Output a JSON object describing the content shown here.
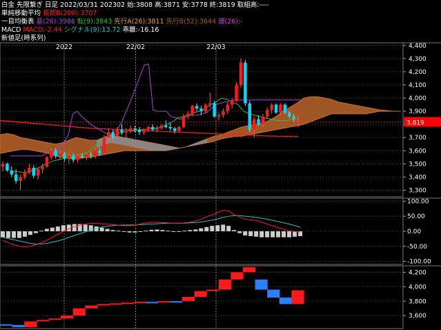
{
  "header": {
    "line1": "白金 先限繋ぎ 日足 2022/03/31 202302 始:3808 高:3871 安:3778 終:3819 取組高:----",
    "ma_label": "単純移動平均",
    "ma_long": "長期B(200):3707",
    "ichimoku_label": "一目均衡表",
    "ichimoku_base": "基(26):3986",
    "ichimoku_conv": "転(9):3843",
    "ichimoku_spanA": "先行A(26):3811",
    "ichimoku_spanB": "先行B(52):3644",
    "ichimoku_lag": "遅(26):-",
    "macd_label": "MACD",
    "macd_value": "MACD:-2.44",
    "macd_signal": "シグナル(9):13.72",
    "macd_hist": "乖離:-16.16",
    "newprice_label": "新値足(時系列)"
  },
  "colors": {
    "up": "#ff1a1a",
    "down": "#00d8ff",
    "cloud": "#b8652a",
    "cloud_neg": "#8a8a8a",
    "kijun": "#b040e0",
    "tenkan": "#30c030",
    "ma200": "#ff2020",
    "macd": "#ff2020",
    "signal": "#30c0c0",
    "hist": "#cccccc",
    "current_price_bg": "#ff0000",
    "grid": "#555555"
  },
  "chart_data": [
    {
      "type": "candlestick",
      "title": "",
      "x_labels": [
        "2022",
        "22/02",
        "22/03"
      ],
      "y_ticks": [
        "4,400",
        "4,300",
        "4,200",
        "4,100",
        "4,000",
        "3,900",
        "3,800",
        "3,700",
        "3,600",
        "3,500",
        "3,400",
        "3,300"
      ],
      "ylim": [
        3250,
        4420
      ],
      "current_price": "3,819",
      "x_range_end": 110,
      "candles": [
        {
          "o": 3480,
          "h": 3520,
          "l": 3440,
          "c": 3500
        },
        {
          "o": 3500,
          "h": 3510,
          "l": 3440,
          "c": 3450
        },
        {
          "o": 3450,
          "h": 3480,
          "l": 3400,
          "c": 3420
        },
        {
          "o": 3420,
          "h": 3460,
          "l": 3350,
          "c": 3370
        },
        {
          "o": 3370,
          "h": 3420,
          "l": 3300,
          "c": 3400
        },
        {
          "o": 3400,
          "h": 3460,
          "l": 3380,
          "c": 3440
        },
        {
          "o": 3440,
          "h": 3500,
          "l": 3420,
          "c": 3470
        },
        {
          "o": 3470,
          "h": 3490,
          "l": 3390,
          "c": 3410
        },
        {
          "o": 3410,
          "h": 3470,
          "l": 3380,
          "c": 3460
        },
        {
          "o": 3460,
          "h": 3500,
          "l": 3430,
          "c": 3480
        },
        {
          "o": 3480,
          "h": 3560,
          "l": 3470,
          "c": 3550
        },
        {
          "o": 3550,
          "h": 3620,
          "l": 3530,
          "c": 3600
        },
        {
          "o": 3600,
          "h": 3620,
          "l": 3540,
          "c": 3560
        },
        {
          "o": 3560,
          "h": 3600,
          "l": 3530,
          "c": 3580
        },
        {
          "o": 3580,
          "h": 3590,
          "l": 3520,
          "c": 3540
        },
        {
          "o": 3540,
          "h": 3580,
          "l": 3500,
          "c": 3560
        },
        {
          "o": 3560,
          "h": 3580,
          "l": 3510,
          "c": 3530
        },
        {
          "o": 3530,
          "h": 3570,
          "l": 3510,
          "c": 3560
        },
        {
          "o": 3560,
          "h": 3580,
          "l": 3540,
          "c": 3550
        },
        {
          "o": 3550,
          "h": 3580,
          "l": 3530,
          "c": 3570
        },
        {
          "o": 3570,
          "h": 3590,
          "l": 3540,
          "c": 3560
        },
        {
          "o": 3560,
          "h": 3620,
          "l": 3540,
          "c": 3600
        },
        {
          "o": 3600,
          "h": 3620,
          "l": 3560,
          "c": 3580
        },
        {
          "o": 3580,
          "h": 3720,
          "l": 3570,
          "c": 3700
        },
        {
          "o": 3700,
          "h": 3770,
          "l": 3680,
          "c": 3740
        },
        {
          "o": 3740,
          "h": 3760,
          "l": 3690,
          "c": 3710
        },
        {
          "o": 3710,
          "h": 3780,
          "l": 3700,
          "c": 3760
        },
        {
          "o": 3760,
          "h": 3800,
          "l": 3720,
          "c": 3740
        },
        {
          "o": 3740,
          "h": 3770,
          "l": 3700,
          "c": 3750
        },
        {
          "o": 3750,
          "h": 3790,
          "l": 3730,
          "c": 3770
        },
        {
          "o": 3770,
          "h": 3790,
          "l": 3740,
          "c": 3760
        },
        {
          "o": 3760,
          "h": 3780,
          "l": 3720,
          "c": 3740
        },
        {
          "o": 3740,
          "h": 3770,
          "l": 3720,
          "c": 3760
        },
        {
          "o": 3760,
          "h": 3790,
          "l": 3740,
          "c": 3780
        },
        {
          "o": 3780,
          "h": 3800,
          "l": 3750,
          "c": 3760
        },
        {
          "o": 3760,
          "h": 3790,
          "l": 3740,
          "c": 3770
        },
        {
          "o": 3770,
          "h": 3800,
          "l": 3760,
          "c": 3790
        },
        {
          "o": 3790,
          "h": 3830,
          "l": 3770,
          "c": 3780
        },
        {
          "o": 3780,
          "h": 3810,
          "l": 3750,
          "c": 3770
        },
        {
          "o": 3770,
          "h": 3780,
          "l": 3730,
          "c": 3750
        },
        {
          "o": 3750,
          "h": 3790,
          "l": 3740,
          "c": 3780
        },
        {
          "o": 3780,
          "h": 3880,
          "l": 3770,
          "c": 3860
        },
        {
          "o": 3860,
          "h": 3900,
          "l": 3840,
          "c": 3880
        },
        {
          "o": 3880,
          "h": 3950,
          "l": 3860,
          "c": 3940
        },
        {
          "o": 3940,
          "h": 3960,
          "l": 3900,
          "c": 3920
        },
        {
          "o": 3920,
          "h": 3940,
          "l": 3870,
          "c": 3900
        },
        {
          "o": 3900,
          "h": 3960,
          "l": 3890,
          "c": 3950
        },
        {
          "o": 3950,
          "h": 4040,
          "l": 3930,
          "c": 3960
        },
        {
          "o": 3960,
          "h": 3980,
          "l": 3850,
          "c": 3860
        },
        {
          "o": 3860,
          "h": 3890,
          "l": 3830,
          "c": 3870
        },
        {
          "o": 3870,
          "h": 3920,
          "l": 3850,
          "c": 3900
        },
        {
          "o": 3900,
          "h": 3970,
          "l": 3880,
          "c": 3950
        },
        {
          "o": 3950,
          "h": 4000,
          "l": 3920,
          "c": 3980
        },
        {
          "o": 3980,
          "h": 4120,
          "l": 3970,
          "c": 4100
        },
        {
          "o": 4100,
          "h": 4300,
          "l": 4080,
          "c": 4270
        },
        {
          "o": 4270,
          "h": 4290,
          "l": 3940,
          "c": 3960
        },
        {
          "o": 3960,
          "h": 3980,
          "l": 3740,
          "c": 3760
        },
        {
          "o": 3760,
          "h": 3860,
          "l": 3700,
          "c": 3840
        },
        {
          "o": 3840,
          "h": 3870,
          "l": 3790,
          "c": 3800
        },
        {
          "o": 3800,
          "h": 3880,
          "l": 3780,
          "c": 3860
        },
        {
          "o": 3860,
          "h": 3930,
          "l": 3840,
          "c": 3910
        },
        {
          "o": 3910,
          "h": 3960,
          "l": 3880,
          "c": 3950
        },
        {
          "o": 3950,
          "h": 3960,
          "l": 3880,
          "c": 3890
        },
        {
          "o": 3890,
          "h": 3960,
          "l": 3870,
          "c": 3950
        },
        {
          "o": 3950,
          "h": 3960,
          "l": 3880,
          "c": 3890
        },
        {
          "o": 3890,
          "h": 3900,
          "l": 3850,
          "c": 3860
        },
        {
          "o": 3860,
          "h": 3880,
          "l": 3820,
          "c": 3840
        },
        {
          "o": 3808,
          "h": 3871,
          "l": 3778,
          "c": 3819
        }
      ],
      "ma200": [
        3830,
        3826,
        3822,
        3818,
        3814,
        3810,
        3806,
        3802,
        3798,
        3794,
        3790,
        3786,
        3782,
        3778,
        3774,
        3770,
        3768,
        3766,
        3764,
        3762,
        3760,
        3758,
        3756,
        3754,
        3752,
        3750,
        3748,
        3746,
        3744,
        3742,
        3740,
        3738,
        3736,
        3734,
        3732,
        3730,
        3728,
        3726,
        3724,
        3722,
        3720,
        3718,
        3716,
        3714,
        3712,
        3711,
        3710,
        3709,
        3708,
        3707
      ],
      "kijun": [
        3560,
        3560,
        3560,
        3560,
        3560,
        3560,
        3560,
        3560,
        3580,
        3580,
        3580,
        3620,
        3660,
        3720,
        3880,
        3900,
        3860,
        3830,
        3800,
        3780,
        3760,
        3740,
        3720,
        3740,
        3760,
        3820,
        3900,
        3980,
        4070,
        4160,
        4250,
        4260,
        3910,
        3900,
        3900,
        3900,
        3860,
        3850,
        3840,
        3850,
        3870,
        3870,
        3870,
        3880,
        3890,
        3920,
        3950,
        3960,
        3970,
        3975,
        3985,
        3985,
        3985,
        3985,
        3985,
        3986,
        3986,
        3986,
        3986,
        3986,
        3986,
        3986,
        3986,
        3986,
        3986,
        3986
      ],
      "tenkan": [
        3440,
        3440,
        3430,
        3440,
        3460,
        3480,
        3500,
        3520,
        3530,
        3540,
        3550,
        3560,
        3570,
        3580,
        3600,
        3640,
        3680,
        3700,
        3720,
        3730,
        3740,
        3750,
        3750,
        3760,
        3760,
        3770,
        3770,
        3780,
        3800,
        3820,
        3850,
        3860,
        3870,
        3890,
        3900,
        3920,
        3950,
        3970,
        4000,
        3990,
        3970,
        3950,
        3900,
        3880,
        3870,
        3860,
        3850,
        3840,
        3830,
        3830,
        3830,
        3840,
        3843
      ],
      "cloud_top": [
        3720,
        3730,
        3720,
        3700,
        3690,
        3680,
        3670,
        3660,
        3650,
        3660,
        3680,
        3700,
        3690,
        3680,
        3680,
        3700,
        3720,
        3710,
        3700,
        3690,
        3680,
        3670,
        3660,
        3650,
        3640,
        3630,
        3620,
        3630,
        3650,
        3670,
        3690,
        3710,
        3720,
        3740,
        3760,
        3780,
        3790,
        3800,
        3810,
        3830,
        3860,
        3900,
        3930,
        3960,
        4000,
        4010,
        4010,
        4000,
        3990,
        3970,
        3960,
        3950,
        3940,
        3930,
        3920,
        3910,
        3905,
        3900,
        3900
      ],
      "cloud_bot": [
        3580,
        3590,
        3600,
        3610,
        3610,
        3600,
        3590,
        3580,
        3560,
        3550,
        3540,
        3540,
        3545,
        3550,
        3560,
        3570,
        3580,
        3590,
        3600,
        3600,
        3600,
        3600,
        3600,
        3600,
        3600,
        3610,
        3620,
        3630,
        3640,
        3650,
        3660,
        3670,
        3690,
        3700,
        3710,
        3710,
        3720,
        3730,
        3740,
        3750,
        3760,
        3770,
        3780,
        3790,
        3800,
        3820,
        3840,
        3860,
        3880,
        3880,
        3880,
        3880,
        3880,
        3880,
        3890,
        3900,
        3900,
        3900,
        3900
      ]
    },
    {
      "type": "macd",
      "title": "",
      "y_ticks": [
        "100.00",
        "50.00",
        "0.00",
        "-50.00",
        "-100.00"
      ],
      "ylim": [
        -110,
        110
      ],
      "macd": [
        -30,
        -38,
        -45,
        -50,
        -52,
        -50,
        -45,
        -38,
        -30,
        -20,
        -10,
        0,
        8,
        15,
        20,
        24,
        26,
        26,
        25,
        24,
        22,
        20,
        18,
        18,
        20,
        24,
        28,
        30,
        30,
        29,
        28,
        27,
        27,
        28,
        30,
        34,
        40,
        48,
        55,
        62,
        70,
        68,
        55,
        48,
        40,
        38,
        36,
        30,
        24,
        18,
        12,
        6,
        2,
        -1,
        -2.44
      ],
      "signal": [
        -20,
        -24,
        -28,
        -32,
        -36,
        -40,
        -42,
        -42,
        -40,
        -36,
        -32,
        -27,
        -20,
        -14,
        -8,
        -2,
        4,
        9,
        14,
        17,
        19,
        20,
        21,
        21,
        21,
        22,
        23,
        24,
        25,
        26,
        27,
        27,
        27,
        27,
        28,
        29,
        31,
        34,
        37,
        41,
        46,
        50,
        52,
        52,
        50,
        48,
        46,
        43,
        40,
        36,
        32,
        28,
        24,
        19,
        13.72
      ],
      "histogram": [
        -20,
        -22,
        -22,
        -22,
        -18,
        -12,
        -6,
        2,
        8,
        12,
        16,
        20,
        22,
        24,
        24,
        22,
        20,
        16,
        12,
        8,
        4,
        2,
        -2,
        -4,
        -4,
        -2,
        2,
        5,
        6,
        4,
        2,
        0,
        0,
        2,
        4,
        6,
        10,
        14,
        18,
        20,
        22,
        18,
        4,
        -6,
        -14,
        -16,
        -18,
        -20,
        -20,
        -20,
        -20,
        -20,
        -20,
        -18,
        -16.16
      ]
    },
    {
      "type": "bar",
      "title": "新値足(時系列)",
      "y_ticks": [
        "4,200",
        "4,000",
        "3,800",
        "3,600"
      ],
      "ylim": [
        3420,
        4290
      ],
      "bricks": [
        {
          "lo": 3470,
          "hi": 3480,
          "up": false
        },
        {
          "lo": 3440,
          "hi": 3470,
          "up": false
        },
        {
          "lo": 3440,
          "hi": 3520,
          "up": true
        },
        {
          "lo": 3520,
          "hi": 3540,
          "up": true
        },
        {
          "lo": 3540,
          "hi": 3560,
          "up": true
        },
        {
          "lo": 3560,
          "hi": 3600,
          "up": true
        },
        {
          "lo": 3600,
          "hi": 3700,
          "up": true
        },
        {
          "lo": 3700,
          "hi": 3740,
          "up": true
        },
        {
          "lo": 3740,
          "hi": 3760,
          "up": true
        },
        {
          "lo": 3760,
          "hi": 3770,
          "up": true
        },
        {
          "lo": 3770,
          "hi": 3780,
          "up": true
        },
        {
          "lo": 3780,
          "hi": 3790,
          "up": true
        },
        {
          "lo": 3770,
          "hi": 3790,
          "up": false
        },
        {
          "lo": 3790,
          "hi": 3800,
          "up": true
        },
        {
          "lo": 3780,
          "hi": 3800,
          "up": false
        },
        {
          "lo": 3800,
          "hi": 3860,
          "up": true
        },
        {
          "lo": 3860,
          "hi": 3940,
          "up": true
        },
        {
          "lo": 3940,
          "hi": 3960,
          "up": true
        },
        {
          "lo": 3960,
          "hi": 4100,
          "up": true
        },
        {
          "lo": 4100,
          "hi": 4200,
          "up": true
        },
        {
          "lo": 4200,
          "hi": 4270,
          "up": true
        },
        {
          "lo": 3960,
          "hi": 4100,
          "up": false
        },
        {
          "lo": 3850,
          "hi": 3960,
          "up": false
        },
        {
          "lo": 3760,
          "hi": 3850,
          "up": false
        },
        {
          "lo": 3760,
          "hi": 3950,
          "up": true
        }
      ]
    }
  ]
}
